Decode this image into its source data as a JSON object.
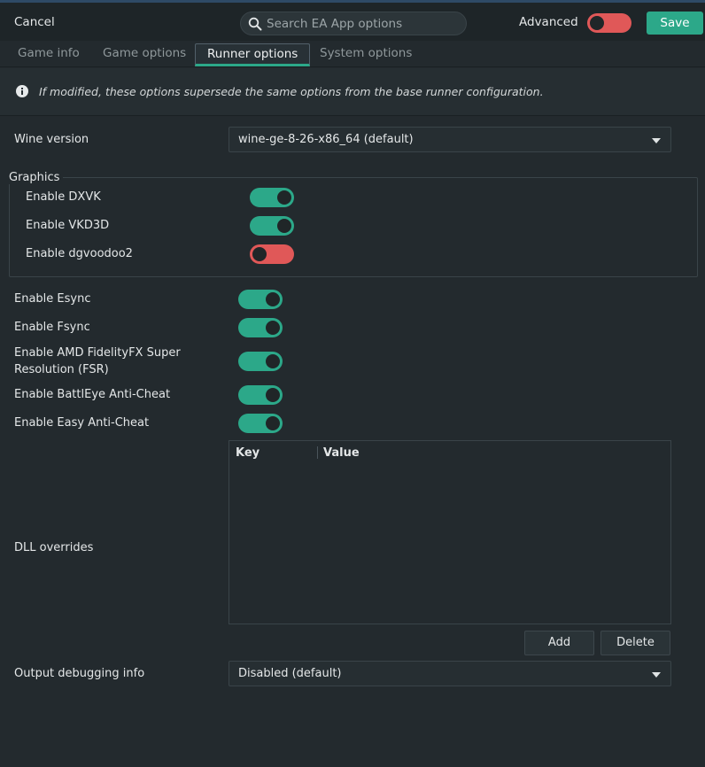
{
  "header": {
    "cancel_label": "Cancel",
    "search_placeholder": "Search EA App options",
    "advanced_label": "Advanced",
    "advanced_on": false,
    "save_label": "Save"
  },
  "tabs": [
    {
      "label": "Game info",
      "active": false
    },
    {
      "label": "Game options",
      "active": false
    },
    {
      "label": "Runner options",
      "active": true
    },
    {
      "label": "System options",
      "active": false
    }
  ],
  "info_text": "If modified, these options supersede the same options from the base runner configuration.",
  "wine_version": {
    "label": "Wine version",
    "value": "wine-ge-8-26-x86_64 (default)"
  },
  "graphics": {
    "title": "Graphics",
    "items": [
      {
        "label": "Enable DXVK",
        "on": true
      },
      {
        "label": "Enable VKD3D",
        "on": true
      },
      {
        "label": "Enable dgvoodoo2",
        "on": false
      }
    ]
  },
  "toggles": [
    {
      "label": "Enable Esync",
      "on": true
    },
    {
      "label": "Enable Fsync",
      "on": true
    },
    {
      "label_line1": "Enable AMD FidelityFX Super",
      "label_line2": "Resolution (FSR)",
      "on": true
    },
    {
      "label": "Enable BattlEye Anti-Cheat",
      "on": true
    },
    {
      "label": "Enable Easy Anti-Cheat",
      "on": true
    }
  ],
  "dll_overrides": {
    "label": "DLL overrides",
    "col_key": "Key",
    "col_value": "Value",
    "add_label": "Add",
    "delete_label": "Delete"
  },
  "debug_output": {
    "label": "Output debugging info",
    "value": "Disabled (default)"
  },
  "colors": {
    "accent": "#2ca889",
    "off": "#e05858",
    "background": "#232a2e"
  }
}
